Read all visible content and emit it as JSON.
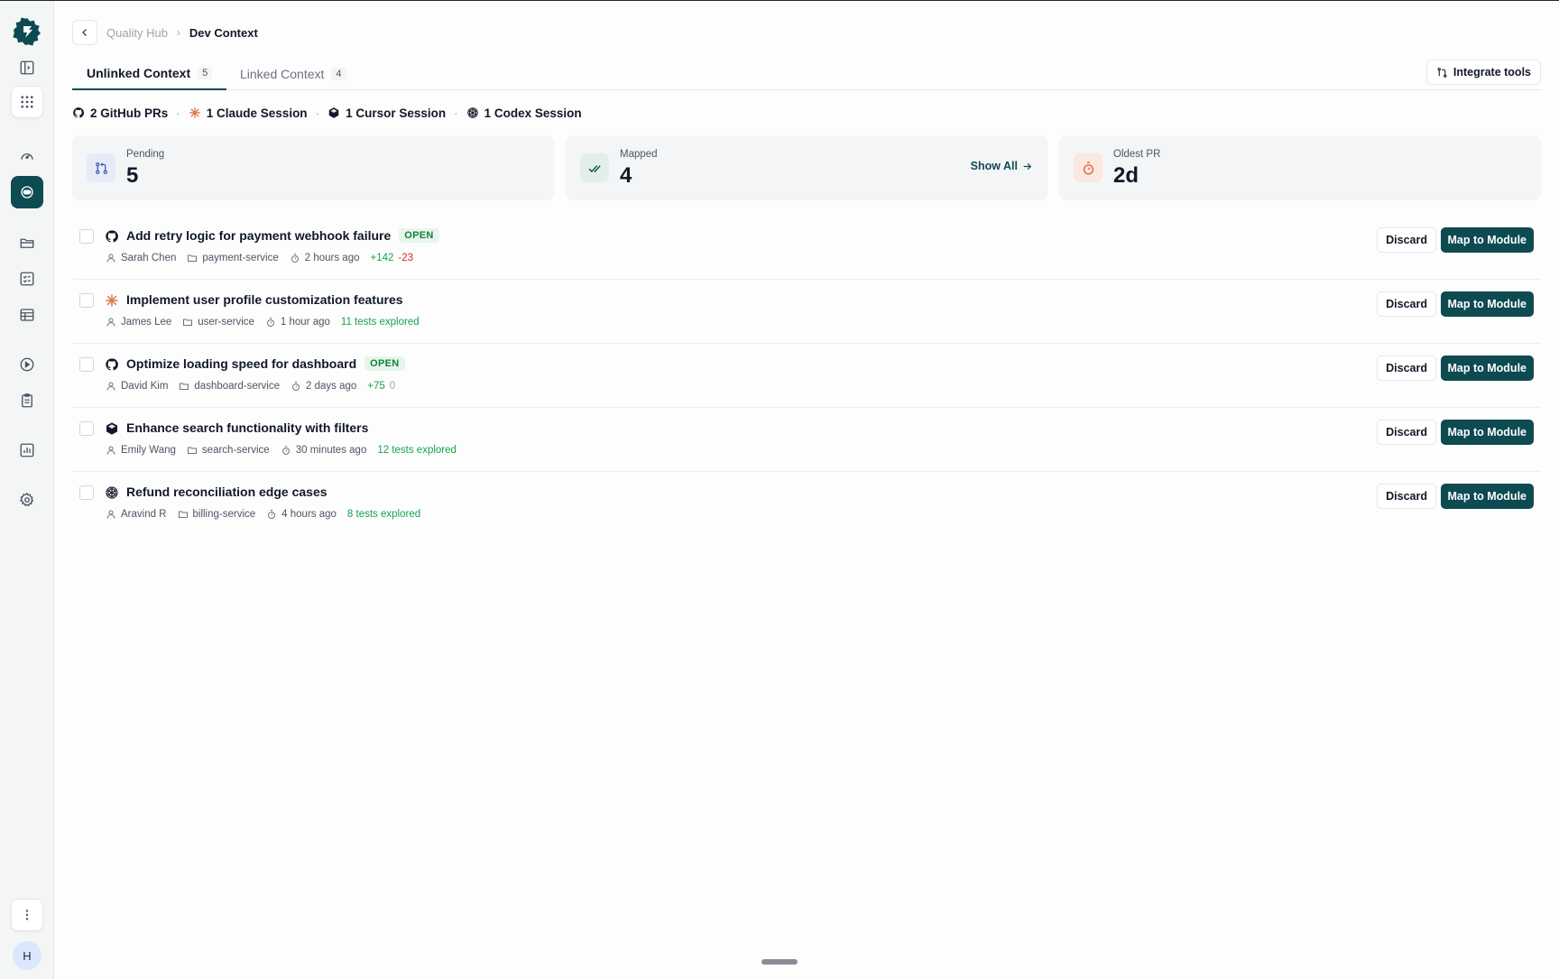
{
  "breadcrumb": {
    "parent": "Quality Hub",
    "current": "Dev Context"
  },
  "tabs": [
    {
      "label": "Unlinked Context",
      "count": "5"
    },
    {
      "label": "Linked Context",
      "count": "4"
    }
  ],
  "toolbar": {
    "integrate_label": "Integrate tools"
  },
  "sources": [
    {
      "label": "2 GitHub PRs",
      "icon": "github-icon"
    },
    {
      "label": "1 Claude Session",
      "icon": "claude-icon"
    },
    {
      "label": "1 Cursor Session",
      "icon": "cursor-icon"
    },
    {
      "label": "1 Codex Session",
      "icon": "codex-icon"
    }
  ],
  "stats": {
    "pending": {
      "label": "Pending",
      "value": "5"
    },
    "mapped": {
      "label": "Mapped",
      "value": "4",
      "action": "Show All"
    },
    "oldest": {
      "label": "Oldest PR",
      "value": "2d"
    }
  },
  "actions": {
    "discard": "Discard",
    "map": "Map to Module"
  },
  "items": [
    {
      "title": "Add retry logic for payment webhook failure",
      "badge": "OPEN",
      "source": "github-icon",
      "author": "Sarah Chen",
      "repo": "payment-service",
      "time": "2 hours ago",
      "added": "+142",
      "removed": "-23"
    },
    {
      "title": "Implement user profile customization features",
      "source": "claude-icon",
      "author": "James Lee",
      "repo": "user-service",
      "time": "1 hour ago",
      "tests": "11 tests explored"
    },
    {
      "title": "Optimize loading speed for dashboard",
      "badge": "OPEN",
      "source": "github-icon",
      "author": "David Kim",
      "repo": "dashboard-service",
      "time": "2 days ago",
      "added": "+75",
      "removed": "0"
    },
    {
      "title": "Enhance search functionality with filters",
      "source": "cursor-icon",
      "author": "Emily Wang",
      "repo": "search-service",
      "time": "30 minutes ago",
      "tests": "12 tests explored"
    },
    {
      "title": "Refund reconciliation edge cases",
      "source": "codex-icon",
      "author": "Aravind R",
      "repo": "billing-service",
      "time": "4 hours ago",
      "tests": "8 tests explored"
    }
  ],
  "user": {
    "initial": "H"
  },
  "colors": {
    "accent": "#0e4a52",
    "add": "#16a34a",
    "remove": "#dc2626",
    "claude": "#e07b53"
  }
}
